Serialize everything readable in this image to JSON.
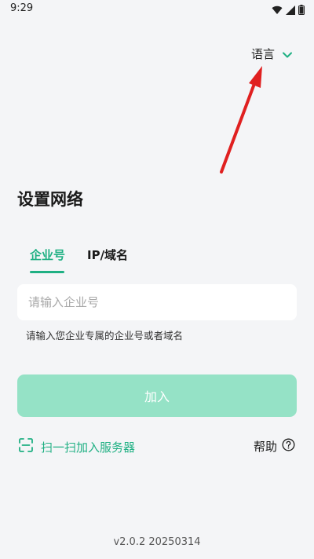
{
  "status_bar": {
    "time": "9:29",
    "icons": [
      "wifi-icon",
      "signal-icon",
      "battery-icon"
    ]
  },
  "header": {
    "language_label": "语言",
    "language_icon": "chevron-down-icon"
  },
  "main": {
    "title": "设置网络",
    "tabs": [
      {
        "label": "企业号",
        "active": true
      },
      {
        "label": "IP/域名",
        "active": false
      }
    ],
    "company_input": {
      "value": "",
      "placeholder": "请输入企业号"
    },
    "hint": "请输入您企业专属的企业号或者域名",
    "join_button": "加入",
    "scan_link": "扫一扫加入服务器",
    "scan_icon": "scan-icon",
    "help_link": "帮助",
    "help_icon": "question-circle-icon"
  },
  "footer": {
    "version": "v2.0.2 20250314"
  },
  "colors": {
    "accent": "#1fb083",
    "button_disabled": "#95e2c6",
    "background": "#f4f5f7",
    "annotation_arrow": "#e02020"
  }
}
